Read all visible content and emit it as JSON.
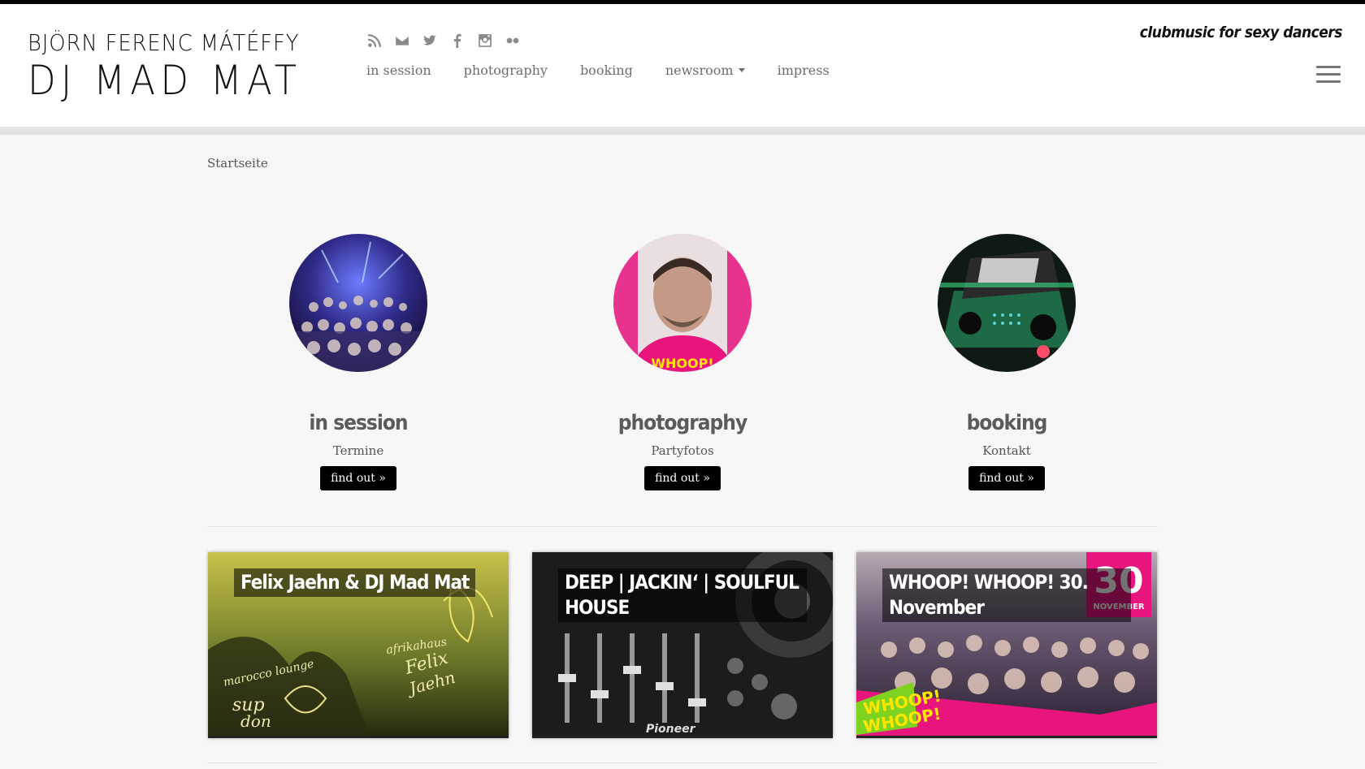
{
  "header": {
    "logo_name": "BJÖRN FERENC MÁTÉFFY",
    "logo_dj": "DJ MAD MAT",
    "tagline": "clubmusic for sexy dancers",
    "social": [
      "rss-icon",
      "mail-icon",
      "twitter-icon",
      "facebook-icon",
      "instagram-icon",
      "flickr-icon"
    ],
    "nav": [
      {
        "label": "in session"
      },
      {
        "label": "photography"
      },
      {
        "label": "booking"
      },
      {
        "label": "newsroom"
      },
      {
        "label": "impress"
      }
    ],
    "menu_icon": "hamburger-icon"
  },
  "breadcrumb": "Startseite",
  "features": [
    {
      "title": "in session",
      "subtitle": "Termine",
      "button": "find out »"
    },
    {
      "title": "photography",
      "subtitle": "Partyfotos",
      "button": "find out »"
    },
    {
      "title": "booking",
      "subtitle": "Kontakt",
      "button": "find out »"
    }
  ],
  "posts": [
    {
      "title": "Felix Jaehn & DJ Mad Mat"
    },
    {
      "title": "DEEP | JACKIN‘ | SOULFUL HOUSE"
    },
    {
      "title": "WHOOP! WHOOP! 30. November"
    }
  ],
  "colors": {
    "accent": "#000000",
    "pink": "#e8157f"
  }
}
